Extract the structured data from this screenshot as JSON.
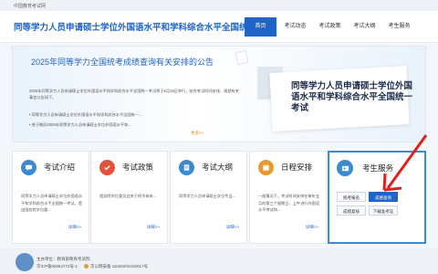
{
  "top_bar": {
    "site_name": "中国教育考试网"
  },
  "header": {
    "title": "同等学力人员申请硕士学位外国语水平和学科综合水平全国统一考试",
    "nav": [
      {
        "label": "首页"
      },
      {
        "label": "考试动态"
      },
      {
        "label": "考试政策"
      },
      {
        "label": "考试大纲"
      },
      {
        "label": "考生服务"
      }
    ]
  },
  "banner": {
    "notice_title": "2025年同等学力全国统考成绩查询有关安排的公告",
    "notice_text": "2025年同等学力人员申请硕士学位外国语水平和学科综合水平全国统一考试将于5月18日举行，结合考试时间安排，现就有关事宜公告如下。",
    "notice_items": [
      "同等学力人员申请硕士学位外国语水平和学科综合水平全国统一...",
      "关于做好2025年同等学力人员申请硕士学位外国语水平和..."
    ],
    "more": "更多>>",
    "big_title": "同等学力人员申请硕士学位外国语水平和学科综合水平全国统一考试"
  },
  "cards": [
    {
      "title": "考试介绍",
      "desc": "同等学力人员申请硕士学位外国语水平和学科综合水平全国统一考试，是由国务院学位委...",
      "more": "详细>>",
      "color": "#3b8ad1"
    },
    {
      "title": "考试政策",
      "desc": "国务院学位委员会关于授予具有...",
      "more": "详细>>",
      "color": "#e0533a"
    },
    {
      "title": "考试大纲",
      "desc": "同等学力人员申请硕士学位专业...",
      "more": "详细>>",
      "color": "#3b8ad1"
    },
    {
      "title": "日程安排",
      "desc": "一般情况下，考试时间安排在每年五月的第三个星期日，上午进行外国语水平考试和...",
      "more": "详细>>",
      "color": "#e99a2c"
    }
  ],
  "service": {
    "title": "考生服务",
    "buttons": [
      {
        "label": "统考报名"
      },
      {
        "label": "成绩查询"
      },
      {
        "label": "成绩复核"
      },
      {
        "label": "下载准考证"
      }
    ]
  },
  "footer": {
    "host": "主办单位：教育部教育考试院",
    "icp": "京ICP备05064772号-1",
    "police": "京公网安备 11040202430017号"
  },
  "colors": {
    "brand": "#1f64c7",
    "accent_arrow": "#e0201c"
  }
}
